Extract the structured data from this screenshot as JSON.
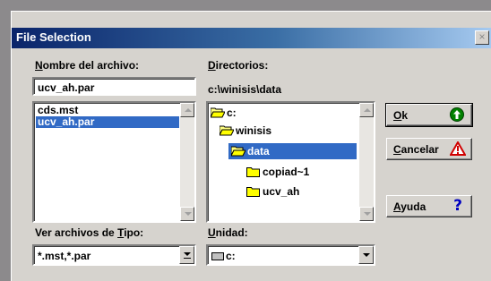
{
  "window": {
    "title": "File Selection",
    "close_glyph": "×"
  },
  "filename": {
    "label_ul": "N",
    "label_rest": "ombre del archivo:",
    "value": "ucv_ah.par",
    "files": [
      "cds.mst",
      "ucv_ah.par"
    ],
    "selected_index": 1
  },
  "directories": {
    "label_ul": "D",
    "label_rest": "irectorios:",
    "current_path": "c:\\winisis\\data",
    "items": [
      "c:",
      "winisis",
      "data",
      "copiad~1",
      "ucv_ah"
    ],
    "selected_index": 2
  },
  "filetype": {
    "label_pre": "Ver archivos de ",
    "label_ul": "T",
    "label_rest": "ipo:",
    "value": "*.mst,*.par"
  },
  "drive": {
    "label_ul": "U",
    "label_rest": "nidad:",
    "value": "c:"
  },
  "buttons": {
    "ok_ul": "O",
    "ok_rest": "k",
    "cancel_ul": "C",
    "cancel_rest": "ancelar",
    "help_ul": "A",
    "help_rest": "yuda"
  },
  "colors": {
    "selection": "#316ac5",
    "ok_icon": "#008000",
    "cancel_icon": "#d00000",
    "help_icon": "#0000c0"
  },
  "icons": [
    "folder-open-icon",
    "folder-closed-icon",
    "drive-icon",
    "ok-arrow-icon",
    "warning-icon",
    "help-question-icon"
  ]
}
